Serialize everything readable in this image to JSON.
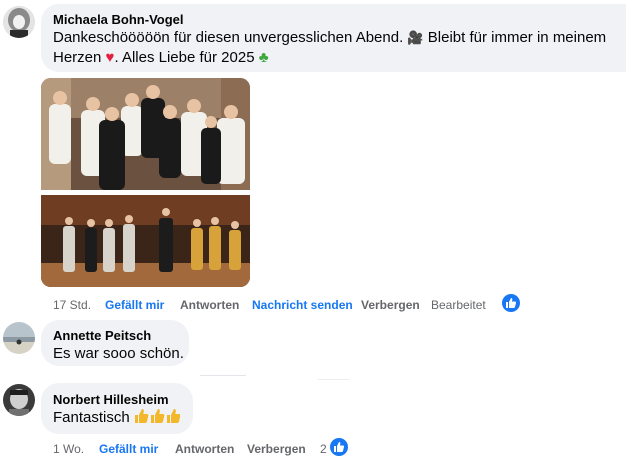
{
  "comments": [
    {
      "author": "Michaela Bohn-Vogel",
      "text_part1": "Dankeschööööön für diesen unvergesslichen Abend.",
      "emoji1": "🎥",
      "text_part2": "Bleibt für immer in meinem",
      "text_part3": "Herzen",
      "emoji2": "❤️",
      "text_part4": ". Alles Liebe für 2025",
      "emoji3": "🍀",
      "actions": {
        "time": "17 Std.",
        "like": "Gefällt mir",
        "reply": "Antworten",
        "message": "Nachricht senden",
        "hide": "Verbergen",
        "edited": "Bearbeitet"
      },
      "reaction": "like-icon"
    },
    {
      "author": "Annette Peitsch",
      "text": "Es war sooo schön."
    },
    {
      "author": "Norbert Hillesheim",
      "text": "Fantastisch",
      "emojis": "👍👍👍",
      "actions": {
        "time": "1 Wo.",
        "like": "Gefällt mir",
        "reply": "Antworten",
        "hide": "Verbergen",
        "reaction_count": "2"
      },
      "reaction": "like-icon"
    }
  ],
  "colors": {
    "bubble": "#f0f2f5",
    "link": "#1877f2",
    "meta": "#65676b"
  }
}
